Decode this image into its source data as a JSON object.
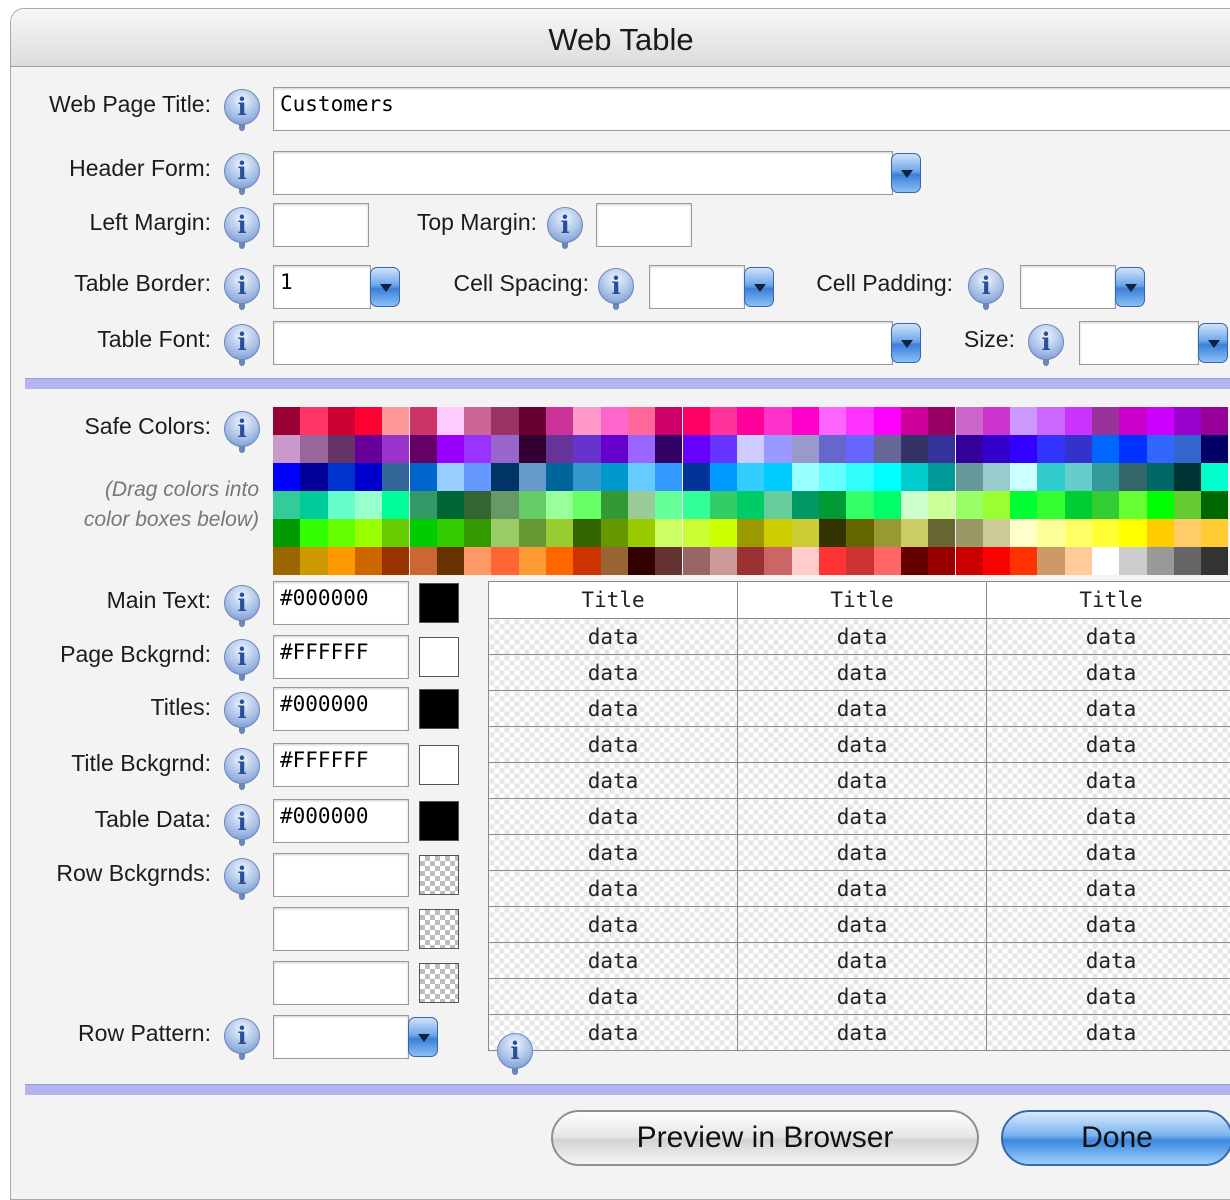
{
  "window": {
    "title": "Web Table"
  },
  "labels": {
    "web_page_title": "Web Page Title:",
    "header_form": "Header Form:",
    "left_margin": "Left Margin:",
    "top_margin": "Top Margin:",
    "table_border": "Table Border:",
    "cell_spacing": "Cell Spacing:",
    "cell_padding": "Cell Padding:",
    "table_font": "Table Font:",
    "size": "Size:",
    "safe_colors": "Safe Colors:",
    "drag_hint_1": "(Drag colors into",
    "drag_hint_2": "color boxes below)",
    "main_text": "Main Text:",
    "page_bckgrnd": "Page Bckgrnd:",
    "titles": "Titles:",
    "title_bckgrnd": "Title Bckgrnd:",
    "table_data": "Table Data:",
    "row_bckgrnds": "Row Bckgrnds:",
    "row_pattern": "Row Pattern:"
  },
  "values": {
    "web_page_title": "Customers",
    "header_form": "",
    "left_margin": "",
    "top_margin": "",
    "table_border": "1",
    "cell_spacing": "",
    "cell_padding": "",
    "table_font": "",
    "size": "",
    "main_text": "#000000",
    "page_bckgrnd": "#FFFFFF",
    "titles": "#000000",
    "title_bckgrnd": "#FFFFFF",
    "table_data": "#000000",
    "row_bg_1": "",
    "row_bg_2": "",
    "row_bg_3": "",
    "row_pattern": ""
  },
  "swatch_colors": {
    "main_text": "#000000",
    "page_bckgrnd": "#FFFFFF",
    "titles": "#000000",
    "title_bckgrnd": "#FFFFFF",
    "table_data": "#000000"
  },
  "preview": {
    "headers": [
      "Title",
      "Title",
      "Title"
    ],
    "cell": "data",
    "row_count": 12
  },
  "buttons": {
    "preview": "Preview in Browser",
    "done": "Done"
  },
  "palette": [
    [
      "#990033",
      "#FF3366",
      "#CC0033",
      "#FF0033",
      "#FF9999",
      "#CC3366",
      "#FFCCFF",
      "#CC6699",
      "#993366",
      "#660033",
      "#CC3399",
      "#FF99CC",
      "#FF66CC",
      "#FF6699",
      "#CC0066",
      "#FF0066",
      "#FF3399",
      "#FF0099",
      "#FF33CC",
      "#FF00CC",
      "#FF66FF",
      "#FF33FF",
      "#FF00FF",
      "#CC0099",
      "#990066",
      "#CC66CC",
      "#CC33CC",
      "#CC99FF",
      "#CC66FF",
      "#CC33FF",
      "#993399",
      "#CC00CC",
      "#CC00FF",
      "#9900CC",
      "#990099"
    ],
    [
      "#CC99CC",
      "#996699",
      "#663366",
      "#660099",
      "#9933CC",
      "#660066",
      "#9900FF",
      "#9933FF",
      "#9966CC",
      "#330033",
      "#663399",
      "#6633CC",
      "#6600CC",
      "#9966FF",
      "#330066",
      "#6600FF",
      "#6633FF",
      "#CCCCFF",
      "#9999FF",
      "#9999CC",
      "#6666CC",
      "#6666FF",
      "#666699",
      "#333366",
      "#333399",
      "#330099",
      "#3300CC",
      "#3300FF",
      "#3333FF",
      "#3333CC",
      "#0066FF",
      "#0033FF",
      "#3366FF",
      "#3366CC",
      "#000066"
    ],
    [
      "#0000FF",
      "#000099",
      "#0033CC",
      "#0000CC",
      "#336699",
      "#0066CC",
      "#99CCFF",
      "#6699FF",
      "#003366",
      "#6699CC",
      "#006699",
      "#3399CC",
      "#0099CC",
      "#66CCFF",
      "#3399FF",
      "#003399",
      "#0099FF",
      "#33CCFF",
      "#00CCFF",
      "#99FFFF",
      "#66FFFF",
      "#33FFFF",
      "#00FFFF",
      "#00CCCC",
      "#009999",
      "#669999",
      "#99CCCC",
      "#CCFFFF",
      "#33CCCC",
      "#66CCCC",
      "#339999",
      "#336666",
      "#006666",
      "#003333",
      "#00FFCC"
    ],
    [
      "#33CC99",
      "#00CC99",
      "#66FFCC",
      "#99FFCC",
      "#00FF99",
      "#339966",
      "#006633",
      "#336633",
      "#669966",
      "#66CC66",
      "#99FF99",
      "#66FF66",
      "#339933",
      "#99CC99",
      "#66FF99",
      "#33FF99",
      "#33CC66",
      "#00CC66",
      "#66CC99",
      "#009966",
      "#009933",
      "#33FF66",
      "#00FF66",
      "#CCFFCC",
      "#CCFF99",
      "#99FF66",
      "#99FF33",
      "#00FF33",
      "#33FF33",
      "#00CC33",
      "#33CC33",
      "#66FF33",
      "#00FF00",
      "#66CC33",
      "#006600"
    ],
    [
      "#009900",
      "#33FF00",
      "#66FF00",
      "#99FF00",
      "#66CC00",
      "#00CC00",
      "#33CC00",
      "#339900",
      "#99CC66",
      "#669933",
      "#99CC33",
      "#336600",
      "#669900",
      "#99CC00",
      "#CCFF66",
      "#CCFF33",
      "#CCFF00",
      "#999900",
      "#CCCC00",
      "#CCCC33",
      "#333300",
      "#666600",
      "#999933",
      "#CCCC66",
      "#666633",
      "#999966",
      "#CCCC99",
      "#FFFFCC",
      "#FFFF99",
      "#FFFF66",
      "#FFFF33",
      "#FFFF00",
      "#FFCC00",
      "#FFCC66",
      "#FFCC33"
    ],
    [
      "#996600",
      "#CC9900",
      "#FF9900",
      "#CC6600",
      "#993300",
      "#CC6633",
      "#663300",
      "#FF9966",
      "#FF6633",
      "#FF9933",
      "#FF6600",
      "#CC3300",
      "#996633",
      "#330000",
      "#663333",
      "#996666",
      "#CC9999",
      "#993333",
      "#CC6666",
      "#FFCCCC",
      "#FF3333",
      "#CC3333",
      "#FF6666",
      "#660000",
      "#990000",
      "#CC0000",
      "#FF0000",
      "#FF3300",
      "#CC9966",
      "#FFCC99",
      "#FFFFFF",
      "#CCCCCC",
      "#999999",
      "#666666",
      "#333333"
    ]
  ]
}
